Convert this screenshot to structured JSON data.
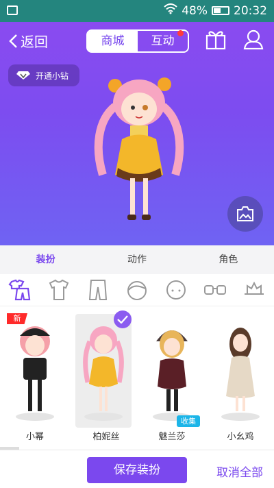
{
  "status_bar": {
    "battery": "48%",
    "time": "20:32"
  },
  "header": {
    "back_label": "返回",
    "tabs": [
      {
        "label": "商城",
        "active": true
      },
      {
        "label": "互动",
        "active": false,
        "has_notification": true
      }
    ]
  },
  "badge": {
    "label": "开通小钻"
  },
  "category_tabs": [
    {
      "label": "装扮",
      "active": true
    },
    {
      "label": "动作"
    },
    {
      "label": "角色"
    }
  ],
  "icon_row": [
    "outfit-icon",
    "shirt-icon",
    "pants-icon",
    "hair-icon",
    "face-icon",
    "glasses-icon",
    "hat-icon"
  ],
  "items": [
    {
      "name": "小幂",
      "tag": "新",
      "hair_color": "#f5a0a8",
      "outfit_color": "#222222"
    },
    {
      "name": "柏妮丝",
      "selected": true,
      "hair_color": "#f7a6c2",
      "outfit_color": "#f3b72a"
    },
    {
      "name": "魅兰莎",
      "tag": "收集",
      "hair_color": "#e8b55a",
      "outfit_color": "#5a1f26"
    },
    {
      "name": "小幺鸡",
      "hair_color": "#5a3b2a",
      "outfit_color": "#e6d9c6"
    }
  ],
  "bottom": {
    "save_label": "保存装扮",
    "cancel_label": "取消全部"
  },
  "colors": {
    "accent": "#7b48ee",
    "status_bar": "#24857e"
  }
}
